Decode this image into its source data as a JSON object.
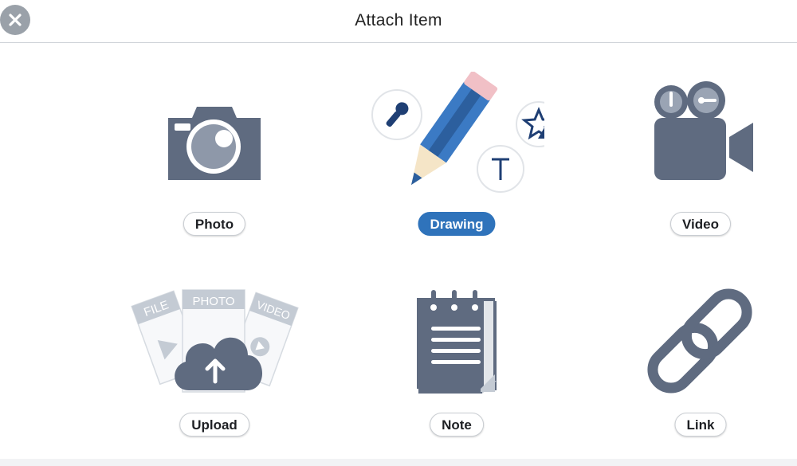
{
  "header": {
    "title": "Attach Item",
    "close_icon": "close-icon"
  },
  "items": [
    {
      "label": "Photo",
      "icon": "camera-icon"
    },
    {
      "label": "Drawing",
      "icon": "pencil-icon",
      "selected": true
    },
    {
      "label": "Video",
      "icon": "video-camera-icon"
    },
    {
      "label": "Upload",
      "icon": "cloud-upload-icon",
      "cards": [
        "FILE",
        "PHOTO",
        "VIDEO"
      ]
    },
    {
      "label": "Note",
      "icon": "notepad-icon"
    },
    {
      "label": "Link",
      "icon": "chain-link-icon"
    }
  ],
  "colors": {
    "icon_slate": "#5f6b80",
    "accent": "#2f73bb",
    "close_bg": "#9aa1a9",
    "card_gray": "#c4cbd4"
  }
}
